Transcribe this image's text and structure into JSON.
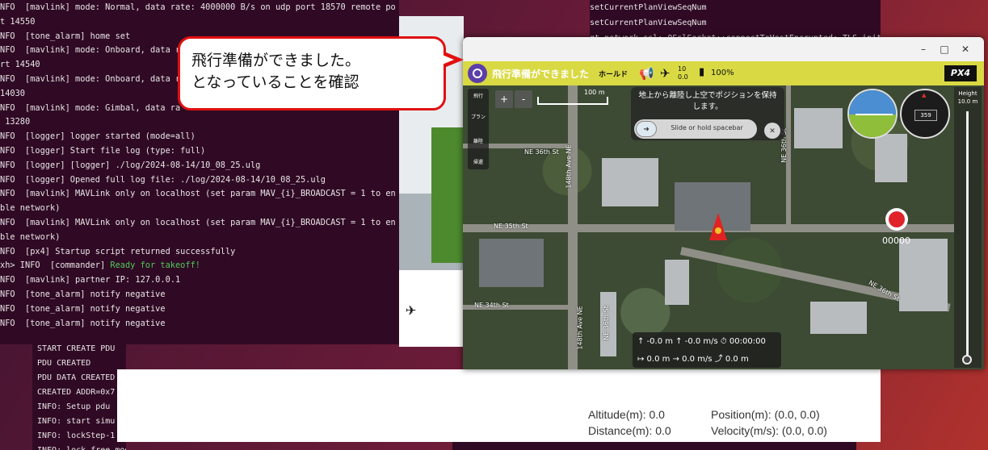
{
  "terminal_main": {
    "lines": [
      "NFO  [mavlink] mode: Normal, data rate: 4000000 B/s on udp port 18570 remote po",
      "t 14550",
      "NFO  [tone_alarm] home set",
      "NFO  [mavlink] mode: Onboard, data r",
      "rt 14540",
      "NFO  [mavlink] mode: Onboard, data r",
      "14030",
      "NFO  [mavlink] mode: Gimbal, data ra",
      " 13280",
      "NFO  [logger] logger started (mode=all)",
      "NFO  [logger] Start file log (type: full)",
      "NFO  [logger] [logger] ./log/2024-08-14/10_08_25.ulg",
      "NFO  [logger] Opened full log file: ./log/2024-08-14/10_08_25.ulg",
      "NFO  [mavlink] MAVLink only on localhost (set param MAV_{i}_BROADCAST = 1 to en",
      "ble network)",
      "NFO  [mavlink] MAVLink only on localhost (set param MAV_{i}_BROADCAST = 1 to en",
      "ble network)",
      "NFO  [px4] Startup script returned successfully",
      "xh> INFO  [commander] Ready for takeoff!",
      "NFO  [mavlink] partner IP: 127.0.0.1",
      "NFO  [tone_alarm] notify negative",
      "NFO  [tone_alarm] notify negative",
      "NFO  [tone_alarm] notify negative"
    ],
    "green_index": 18
  },
  "terminal_right": {
    "lines": [
      "setCurrentPlanViewSeqNum",
      "setCurrentPlanViewSeqNum",
      "qt.network.ssl: QSslSocket::connectToHostEncrypted: TLS initialization failed"
    ]
  },
  "terminal_bottom": {
    "lines": [
      "START CREATE PDU",
      "PDU CREATED",
      "PDU DATA CREATED",
      "CREATED ADDR=0x7",
      "INFO: Setup pdu",
      "INFO: start simu",
      "INFO: lockStep-1",
      "INFO: lock free mode for all instance received controls"
    ]
  },
  "sim_info": {
    "altitude": "Altitude(m): 0.0",
    "position": "Position(m): (0.0, 0.0)",
    "distance": "Distance(m): 0.0",
    "velocity": "Velocity(m/s): (0.0, 0.0)"
  },
  "callout": {
    "text": "飛行準備ができました。\nとなっていることを確認"
  },
  "qgc": {
    "window_buttons": [
      "–",
      "□",
      "✕"
    ],
    "toolbar": {
      "status": "飛行準備ができました",
      "mode": "ホールド",
      "sat_count": "10",
      "hdop": "0.0",
      "battery": "100%",
      "brand": "PX4"
    },
    "left_panel": [
      "飛行",
      "プラン",
      "離陸",
      "帰還"
    ],
    "zoom": [
      "+",
      "-"
    ],
    "scale_label": "100 m",
    "takeoff": {
      "message": "地上から離陸し上空でポジションを保持します。",
      "slider_label": "Slide or hold spacebar"
    },
    "compass_heading": "359",
    "height_label": "Height",
    "height_value": "10.0 m",
    "record_time": "00000",
    "telemetry": {
      "row1": "↑ -0.0 m   ↑ -0.0 m/s   ⏱ 00:00:00",
      "row2": "↦ 0.0 m   → 0.0 m/s   ⤴ 0.0 m"
    },
    "roads": [
      "NE 36th St",
      "NE 35th St",
      "NE 36th St",
      "148th Ave NE",
      "148th Ave NE",
      "NE 36th St",
      "NE 36th St",
      "NE 34th St"
    ]
  }
}
